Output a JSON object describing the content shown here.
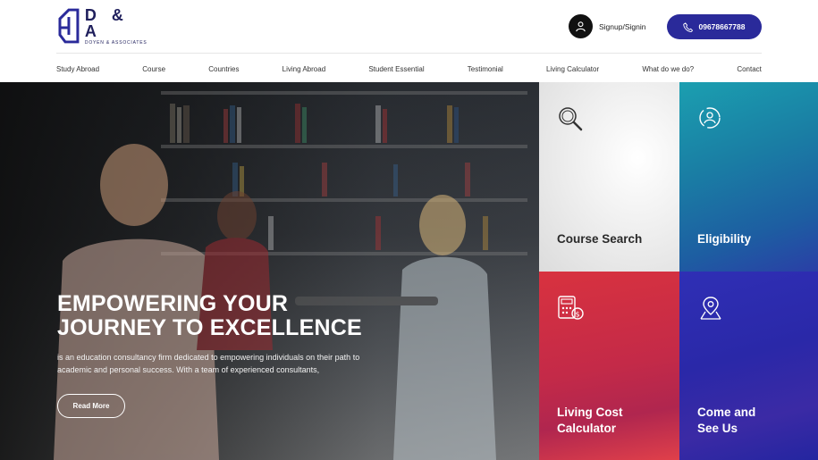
{
  "brand": {
    "name": "D & A",
    "tagline": "DOYEN & ASSOCIATES"
  },
  "header": {
    "signup_label": "Signup/Signin",
    "phone": "09678667788"
  },
  "nav": [
    {
      "label": "Study Abroad"
    },
    {
      "label": "Course"
    },
    {
      "label": "Countries"
    },
    {
      "label": "Living Abroad"
    },
    {
      "label": "Student Essential"
    },
    {
      "label": "Testimonial"
    },
    {
      "label": "Living Calculator"
    },
    {
      "label": "What do we do?"
    },
    {
      "label": "Contact"
    }
  ],
  "hero": {
    "title_line1": "EMPOWERING YOUR",
    "title_line2": "JOURNEY TO EXCELLENCE",
    "description": "is an education consultancy firm dedicated to empowering individuals on their path to academic and personal success. With a team of experienced consultants,",
    "cta": "Read More"
  },
  "tiles": [
    {
      "label_line1": "Course Search",
      "label_line2": "",
      "icon": "search-icon"
    },
    {
      "label_line1": "Eligibility",
      "label_line2": "",
      "icon": "eligibility-icon"
    },
    {
      "label_line1": "Living Cost",
      "label_line2": "Calculator",
      "icon": "calculator-icon"
    },
    {
      "label_line1": "Come and",
      "label_line2": "See Us",
      "icon": "map-pin-icon"
    }
  ],
  "colors": {
    "brand_navy": "#1f1f5c",
    "button_blue": "#2a2a9a",
    "tile_teal": "#1a7ea4",
    "tile_red": "#c42a48",
    "tile_indigo": "#2a28a8"
  }
}
